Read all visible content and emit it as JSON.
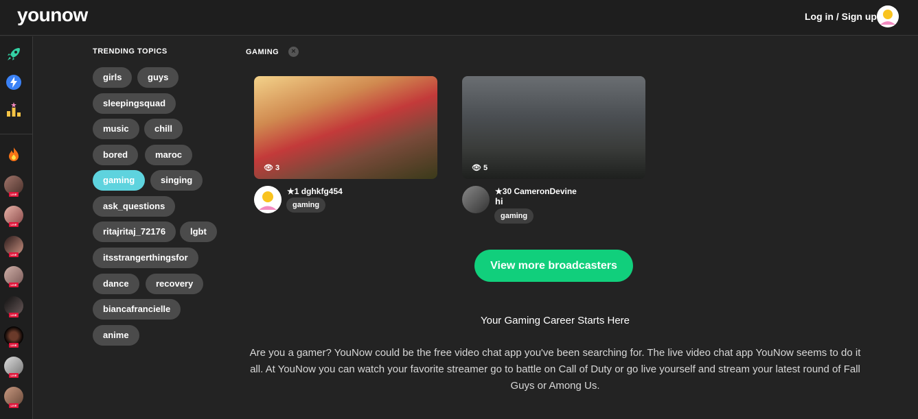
{
  "header": {
    "logo": "younow",
    "login_label": "Log in / Sign up"
  },
  "sidebar": {
    "icons": [
      "rocket-icon",
      "lightning-icon",
      "leaderboard-icon",
      "fire-icon"
    ],
    "live_badge": "LIVE",
    "live_count": 8
  },
  "trending": {
    "title": "TRENDING TOPICS",
    "topics": [
      "girls",
      "guys",
      "sleepingsquad",
      "music",
      "chill",
      "bored",
      "maroc",
      "gaming",
      "singing",
      "ask_questions",
      "ritajritaj_72176",
      "lgbt",
      "itsstrangerthingsfor",
      "dance",
      "recovery",
      "biancafrancielle",
      "anime"
    ],
    "active": "gaming"
  },
  "main": {
    "category": "GAMING",
    "cards": [
      {
        "views": "3",
        "level": "1",
        "username": "dghkfg454",
        "title": "",
        "tag": "gaming"
      },
      {
        "views": "5",
        "level": "30",
        "username": "CameronDevine",
        "title": "hi",
        "tag": "gaming"
      }
    ],
    "cta_label": "View more broadcasters",
    "subheading": "Your Gaming Career Starts Here",
    "paragraph": "Are you a gamer? YouNow could be the free video chat app you've been searching for. The live video chat app YouNow seems to do it all. At YouNow you can watch your favorite streamer go to battle on Call of Duty or go live yourself and stream your latest round of Fall Guys or Among Us."
  },
  "colors": {
    "background": "#232323",
    "chip": "#4b4b4b",
    "chip_active": "#5ed3de",
    "cta": "#11cf7c",
    "live": "#e0163b"
  }
}
